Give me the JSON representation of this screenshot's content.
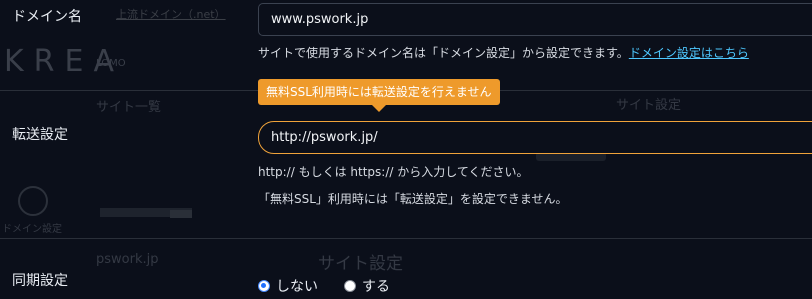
{
  "background": {
    "logo": "KREA",
    "logo_sub": "LOMO",
    "breadcrumb": "上流ドメイン（.net）",
    "site_list": "サイト一覧",
    "site_settings": "サイト設定",
    "domain_settings": "ドメイン設定",
    "site_name": "pswork.jp",
    "site_settings_2": "サイト設定"
  },
  "form": {
    "domain": {
      "label": "ドメイン名",
      "value": "www.pswork.jp",
      "help_text": "サイトで使用するドメイン名は「ドメイン設定」から設定できます。",
      "help_link": "ドメイン設定はこちら"
    },
    "tooltip": "無料SSL利用時には転送設定を行えません",
    "redirect": {
      "label": "転送設定",
      "value": "http://pswork.jp/",
      "help_1": "http:// もしくは https:// から入力してください。",
      "help_2": "「無料SSL」利用時には「転送設定」を設定できません。"
    },
    "sync": {
      "label": "同期設定",
      "options": [
        {
          "label": "しない",
          "selected": true
        },
        {
          "label": "する",
          "selected": false
        }
      ]
    }
  },
  "colors": {
    "accent_orange": "#ee9a2b",
    "link_blue": "#4ec8ff",
    "radio_blue": "#1f6fff"
  }
}
